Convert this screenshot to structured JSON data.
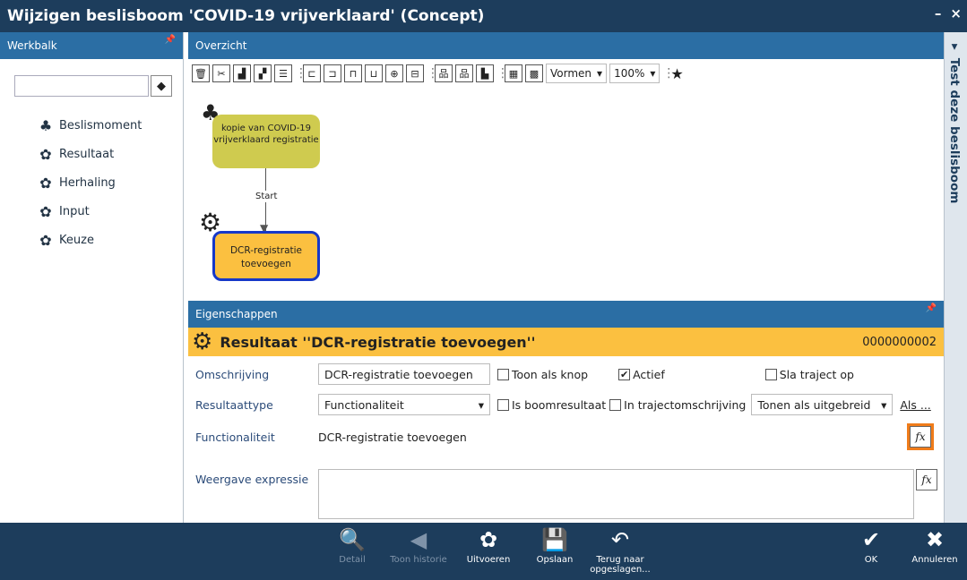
{
  "window": {
    "title": "Wijzigen beslisboom 'COVID-19 vrijverklaard' (Concept)",
    "minimize": "–",
    "close": "×"
  },
  "werkbalk": {
    "title": "Werkbalk",
    "items": [
      {
        "label": "Beslismoment",
        "icon": "tree-icon"
      },
      {
        "label": "Resultaat",
        "icon": "gear-icon"
      },
      {
        "label": "Herhaling",
        "icon": "repeat-icon"
      },
      {
        "label": "Input",
        "icon": "input-icon"
      },
      {
        "label": "Keuze",
        "icon": "choice-icon"
      }
    ]
  },
  "overzicht": {
    "title": "Overzicht",
    "vormen_label": "Vormen",
    "zoom": "100%",
    "nodes": {
      "root": "kopie van COVID-19 vrijverklaard registratie",
      "result": "DCR-registratie toevoegen"
    },
    "connector_label": "Start"
  },
  "eigenschappen": {
    "title": "Eigenschappen",
    "banner_title": "Resultaat ''DCR-registratie toevoegen''",
    "banner_number": "0000000002",
    "omschrijving_label": "Omschrijving",
    "omschrijving_value": "DCR-registratie toevoegen",
    "toon_als_knop": "Toon als knop",
    "actief": "Actief",
    "sla_traject_op": "Sla traject op",
    "resultaattype_label": "Resultaattype",
    "resultaattype_value": "Functionaliteit",
    "is_boomresultaat": "Is boomresultaat",
    "in_trajectomschrijving": "In trajectomschrijving",
    "tonen_als": "Tonen als uitgebreid",
    "als_link": "Als ...",
    "functionaliteit_label": "Functionaliteit",
    "functionaliteit_value": "DCR-registratie toevoegen",
    "weergave_label": "Weergave expressie",
    "fx": "fx"
  },
  "right_tab": "Test deze beslisboom",
  "bottombar": {
    "detail": "Detail",
    "toon_historie": "Toon historie",
    "uitvoeren": "Uitvoeren",
    "opslaan": "Opslaan",
    "terug": "Terug naar opgeslagen...",
    "ok": "OK",
    "annuleren": "Annuleren"
  },
  "colors": {
    "header": "#1d3d5c",
    "panel": "#2b6ea4",
    "accent": "#fbc040",
    "node_root": "#cfcb4f"
  }
}
